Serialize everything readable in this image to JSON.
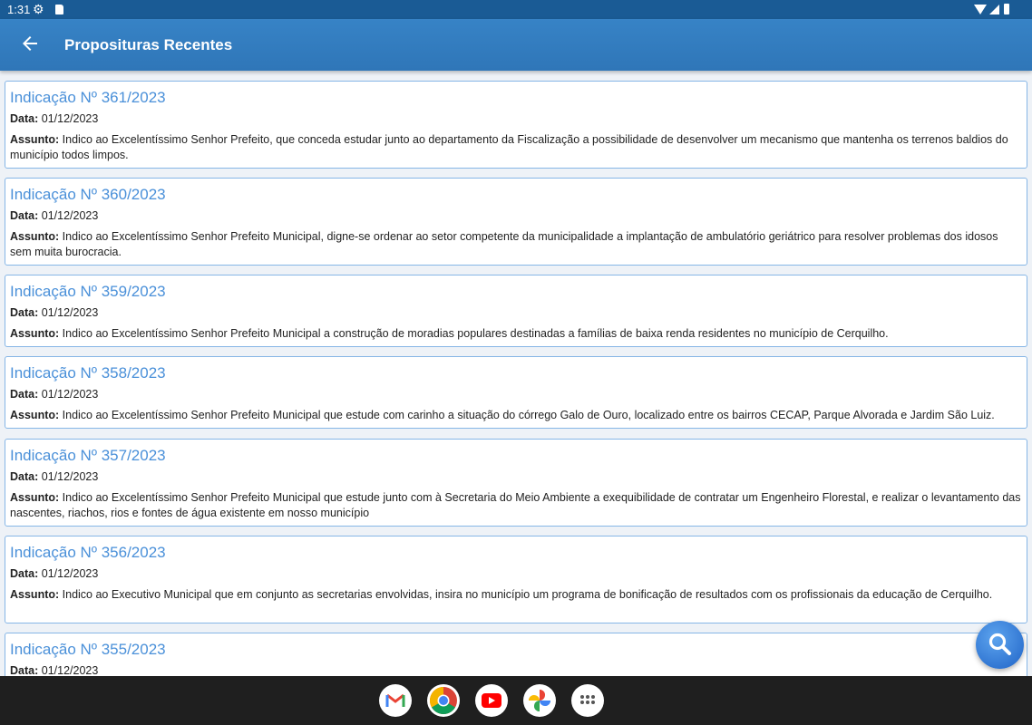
{
  "status_bar": {
    "time": "1:31",
    "icons": [
      "settings-gear-icon",
      "sd-card-icon",
      "wifi-icon",
      "signal-icon",
      "battery-icon"
    ]
  },
  "app_bar": {
    "title": "Proposituras Recentes",
    "back_icon": "arrow-back-icon",
    "color": "#3380c2"
  },
  "labels": {
    "date": "Data:",
    "subject": "Assunto:"
  },
  "items": [
    {
      "title": "Indicação Nº 361/2023",
      "date": "01/12/2023",
      "subject": "Indico ao Excelentíssimo Senhor Prefeito, que conceda estudar junto ao departamento da Fiscalização a possibilidade de desenvolver um mecanismo que mantenha os terrenos baldios do município todos limpos."
    },
    {
      "title": "Indicação Nº 360/2023",
      "date": "01/12/2023",
      "subject": "Indico ao Excelentíssimo Senhor Prefeito Municipal, digne-se ordenar ao setor competente da municipalidade a implantação de ambulatório geriátrico para resolver problemas dos idosos sem muita burocracia."
    },
    {
      "title": "Indicação Nº 359/2023",
      "date": "01/12/2023",
      "subject": "Indico ao Excelentíssimo Senhor Prefeito Municipal a construção de moradias populares destinadas a famílias de baixa renda residentes no município de Cerquilho."
    },
    {
      "title": "Indicação Nº 358/2023",
      "date": "01/12/2023",
      "subject": "Indico ao Excelentíssimo Senhor Prefeito Municipal que estude com carinho a situação do córrego Galo de Ouro, localizado entre os bairros CECAP, Parque Alvorada e Jardim São Luiz."
    },
    {
      "title": "Indicação Nº 357/2023",
      "date": "01/12/2023",
      "subject": "Indico ao Excelentíssimo Senhor Prefeito Municipal que estude junto com à Secretaria do Meio Ambiente a exequibilidade de contratar um Engenheiro Florestal, e realizar o levantamento das nascentes, riachos, rios e fontes de água existente em nosso município"
    },
    {
      "title": "Indicação Nº 356/2023",
      "date": "01/12/2023",
      "subject": "Indico ao Executivo Municipal que em conjunto as secretarias envolvidas, insira no município um programa de bonificação de resultados com os profissionais da educação de Cerquilho."
    },
    {
      "title": "Indicação Nº 355/2023",
      "date": "01/12/2023",
      "subject": ""
    }
  ],
  "fab_icon": "search-icon",
  "dock_apps": [
    "gmail-icon",
    "chrome-icon",
    "youtube-icon",
    "photos-icon",
    "app-drawer-icon"
  ]
}
